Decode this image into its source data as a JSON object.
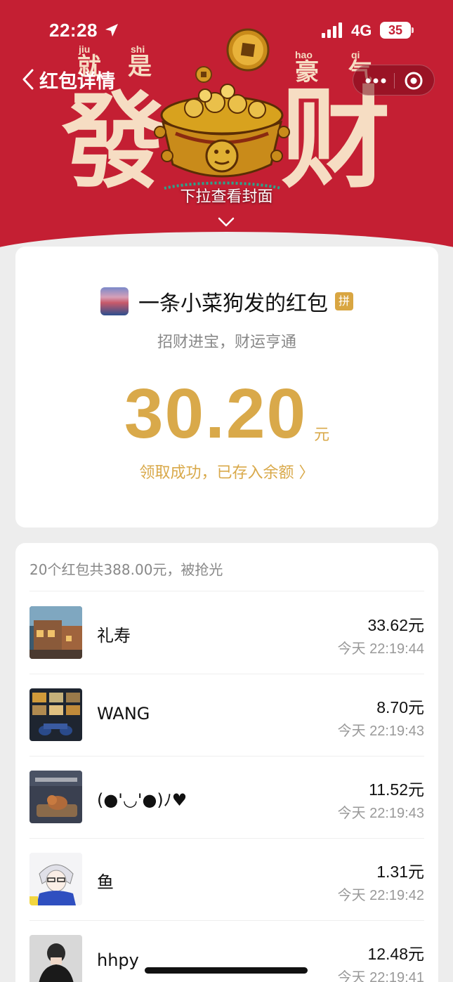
{
  "status_bar": {
    "time": "22:28",
    "network": "4G",
    "battery": "35"
  },
  "nav": {
    "title": "红包详情"
  },
  "cover": {
    "deco_left_big": "發",
    "deco_right_big": "财",
    "deco_small": [
      "就",
      "是",
      "豪",
      "气"
    ],
    "pinyin": [
      "jiu",
      "shi",
      "hao",
      "qi"
    ],
    "pull_hint": "下拉查看封面"
  },
  "packet": {
    "sender_title": "一条小菜狗发的红包",
    "badge": "拼",
    "blessing": "招财进宝，财运亨通",
    "amount": "30.20",
    "unit": "元",
    "received_text": "领取成功，已存入余额 〉"
  },
  "list": {
    "summary": "20个红包共388.00元，被抢光",
    "records": [
      {
        "name": "礼寿",
        "amount": "33.62元",
        "time": "今天 22:19:44",
        "avatar": "street-scene"
      },
      {
        "name": "WANG",
        "amount": "8.70元",
        "time": "今天 22:19:43",
        "avatar": "shelf-motorbike"
      },
      {
        "name": "(●'◡'●)ﾉ♥",
        "amount": "11.52元",
        "time": "今天 22:19:43",
        "avatar": "cartoon-cat"
      },
      {
        "name": "鱼",
        "amount": "1.31元",
        "time": "今天 22:19:42",
        "avatar": "anime-boy"
      },
      {
        "name": "hhpy",
        "amount": "12.48元",
        "time": "今天 22:19:41",
        "avatar": "person-dark"
      }
    ]
  },
  "colors": {
    "cover_red": "#c41f33",
    "gold": "#d9a94a",
    "cream": "#f6ddc3"
  }
}
